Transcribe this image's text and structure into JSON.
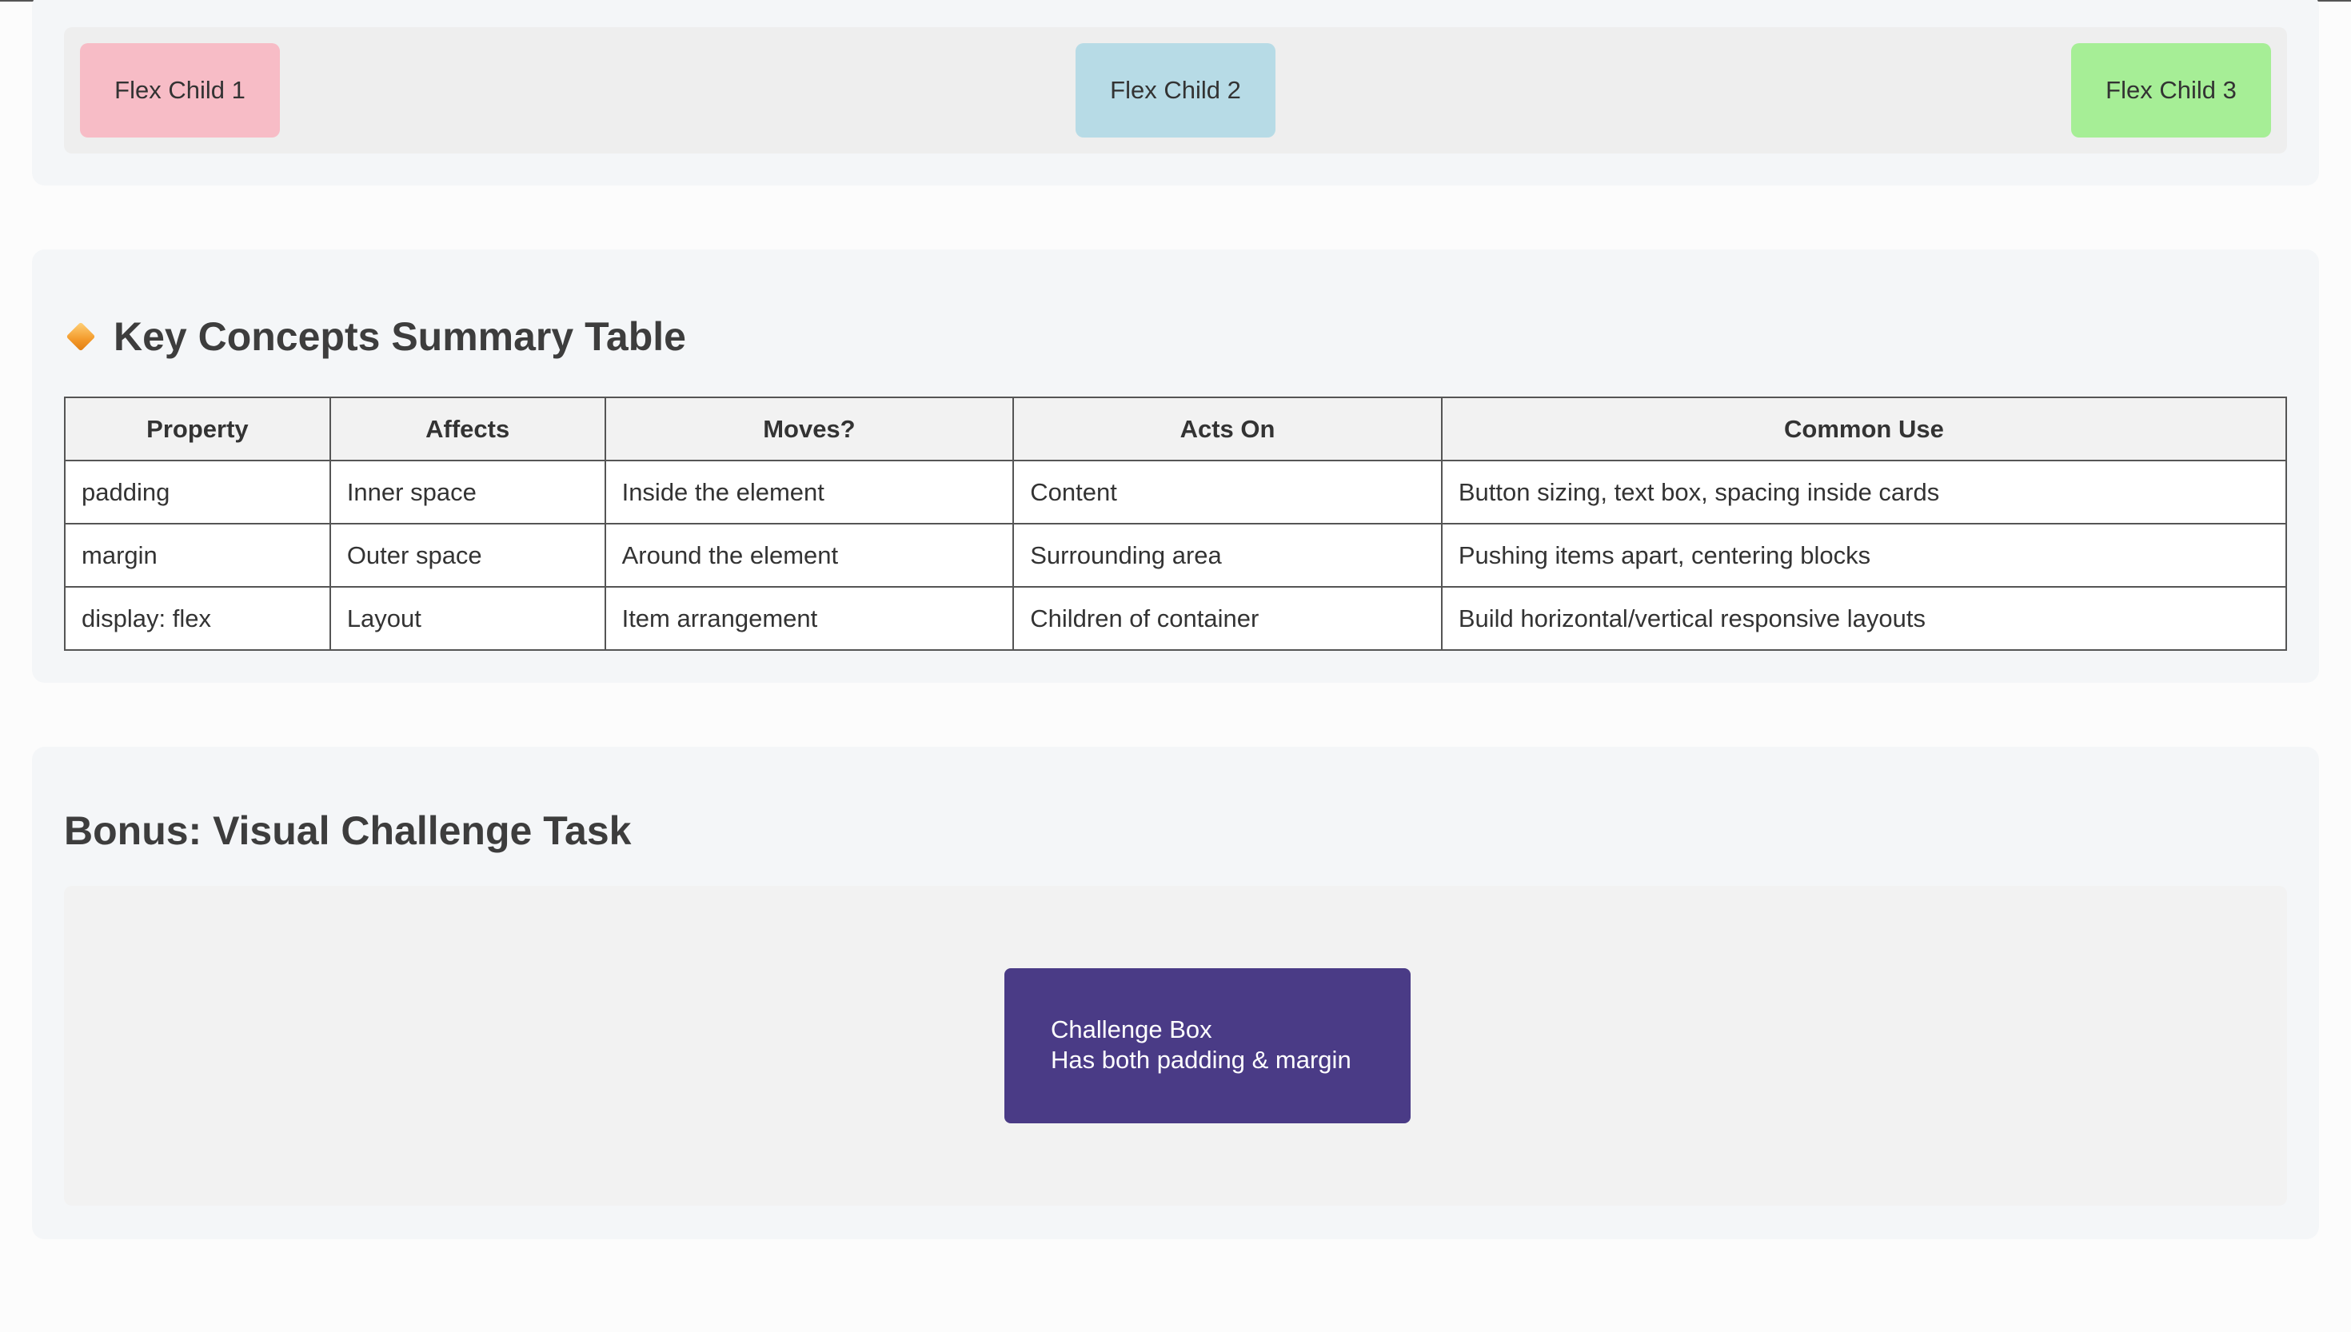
{
  "flex_demo": {
    "children": [
      "Flex Child 1",
      "Flex Child 2",
      "Flex Child 3"
    ]
  },
  "summary": {
    "title": "Key Concepts Summary Table",
    "title_icon": "diamond-icon",
    "columns": [
      "Property",
      "Affects",
      "Moves?",
      "Acts On",
      "Common Use"
    ],
    "rows": [
      [
        "padding",
        "Inner space",
        "Inside the element",
        "Content",
        "Button sizing, text box, spacing inside cards"
      ],
      [
        "margin",
        "Outer space",
        "Around the element",
        "Surrounding area",
        "Pushing items apart, centering blocks"
      ],
      [
        "display: flex",
        "Layout",
        "Item arrangement",
        "Children of container",
        "Build horizontal/vertical responsive layouts"
      ]
    ]
  },
  "bonus": {
    "title": "Bonus: Visual Challenge Task",
    "box_line1": "Challenge Box",
    "box_line2": "Has both padding & margin"
  },
  "colors": {
    "flex_child_1": "#f7bcc6",
    "flex_child_2": "#b7dbe6",
    "flex_child_3": "#a6ee96",
    "challenge_box": "#4a3b86",
    "icon_accent": "#f39a2b"
  }
}
